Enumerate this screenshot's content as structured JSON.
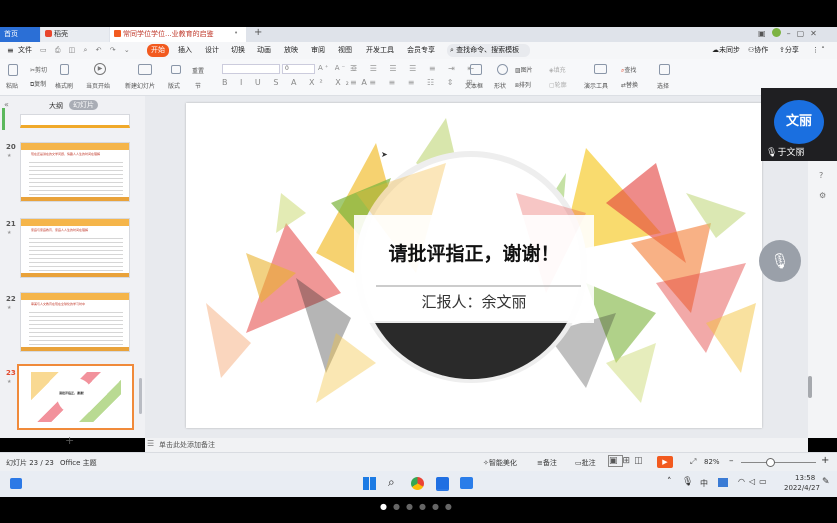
{
  "tabs": {
    "home": "首页",
    "docer": "稻壳",
    "doc": "常同学位学位...业教育的启鉴"
  },
  "menu": {
    "file": "文件",
    "items": [
      "开始",
      "插入",
      "设计",
      "切换",
      "动画",
      "放映",
      "审阅",
      "视图",
      "开发工具",
      "会员专享"
    ],
    "search": "查找命令、搜索模板",
    "right": [
      "未同步",
      "协作",
      "分享"
    ]
  },
  "toolbar": {
    "paste": "粘贴",
    "cut": "剪切",
    "copy": "复制",
    "format_painter": "格式刷",
    "from_current": "当页开始",
    "new_slide": "新建幻灯片",
    "layout": "版式",
    "section": "节",
    "reset": "重置",
    "font_size": "0",
    "text_box": "文本框",
    "shape": "形状",
    "picture": "图片",
    "arrange": "排列",
    "fill": "填充",
    "outline": "轮廓",
    "presenter": "演示工具",
    "find": "查找",
    "replace": "替换",
    "select": "选择"
  },
  "left_panel": {
    "outline_tab": "大纲",
    "slides_tab": "幻灯片",
    "slides": [
      {
        "num": "20",
        "title": "现在还是讲在的文学问题，情趣人人生的时间在理解"
      },
      {
        "num": "21",
        "title": "家庭与家庭教育、家庭人人生的时间在理解"
      },
      {
        "num": "22",
        "title": "审美与人文教育在现在全球化的学习时中"
      },
      {
        "num": "23",
        "title": "请批评指正，谢谢！"
      }
    ]
  },
  "slide": {
    "title": "请批评指正，谢谢！",
    "reporter": "汇报人：余文丽"
  },
  "notes_hint": "单击此处添加备注",
  "status": {
    "slide_count": "幻灯片 23 / 23",
    "theme": "Office 主题",
    "smart_beautify": "智能美化",
    "notes": "备注",
    "comments": "批注",
    "zoom": "82%"
  },
  "meeting": {
    "avatar_text": "文丽",
    "speaker": "于文丽",
    "avatar_color": "#1a6fe0"
  },
  "taskbar": {
    "time": "13:58",
    "date": "2022/4/27",
    "ime": "中"
  },
  "colors": {
    "accent_orange": "#f25a1f",
    "active_tab": "#ffffff",
    "home_tab": "#2b6fd6"
  }
}
